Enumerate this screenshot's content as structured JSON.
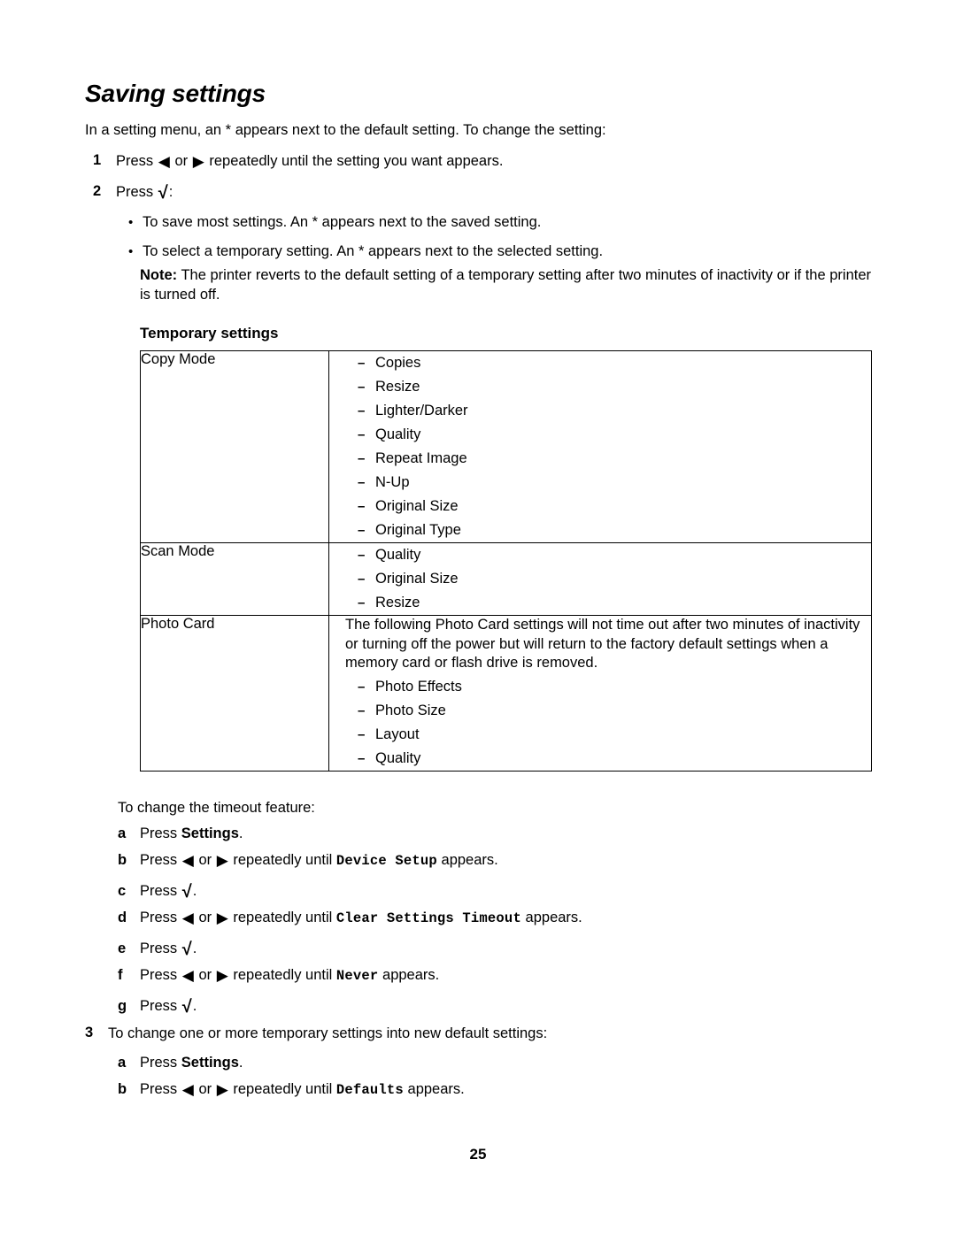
{
  "document": {
    "title": "Saving settings",
    "intro": "In a setting menu, an * appears next to the default setting. To change the setting:",
    "page_number": "25"
  },
  "glyphs": {
    "left_arrow": "◀",
    "right_arrow": "▶",
    "check": "√",
    "bullet": "•",
    "dash": "–"
  },
  "steps": {
    "step1": {
      "marker": "1",
      "text_before": "Press",
      "text_or": "or",
      "text_after": "repeatedly until the setting you want appears."
    },
    "step2": {
      "marker": "2",
      "text_before": "Press",
      "text_after": ":"
    },
    "step3": {
      "marker": "3",
      "text": "To change one or more temporary settings into new default settings:"
    }
  },
  "bullets": [
    {
      "text": "To save most settings. An * appears next to the saved setting."
    },
    {
      "text": "To select a temporary setting. An * appears next to the selected setting."
    }
  ],
  "note": {
    "label": "Note:",
    "text": "The printer reverts to the default setting of a temporary setting after two minutes of inactivity or if the printer is turned off."
  },
  "table": {
    "heading": "Temporary settings",
    "rows": [
      {
        "label": "Copy Mode",
        "paragraph": "",
        "items": [
          "Copies",
          "Resize",
          "Lighter/Darker",
          "Quality",
          "Repeat Image",
          "N-Up",
          "Original Size",
          "Original Type"
        ]
      },
      {
        "label": "Scan Mode",
        "paragraph": "",
        "items": [
          "Quality",
          "Original Size",
          "Resize"
        ]
      },
      {
        "label": "Photo Card",
        "paragraph": "The following Photo Card settings will not time out after two minutes of inactivity or turning off the power but will return to the factory default settings when a memory card or flash drive is removed.",
        "items": [
          "Photo Effects",
          "Photo Size",
          "Layout",
          "Quality"
        ]
      }
    ]
  },
  "timeout_section": {
    "lead": "To change the timeout feature:",
    "steps": [
      {
        "marker": "a",
        "press": "Press",
        "bold_term": "Settings",
        "suffix": "."
      },
      {
        "marker": "b",
        "press": "Press",
        "or": "or",
        "until": "repeatedly until",
        "mono_term": "Device Setup",
        "suffix": "appears."
      },
      {
        "marker": "c",
        "press": "Press",
        "suffix": "."
      },
      {
        "marker": "d",
        "press": "Press",
        "or": "or",
        "until": "repeatedly until",
        "mono_term": "Clear Settings Timeout",
        "suffix": "appears."
      },
      {
        "marker": "e",
        "press": "Press",
        "suffix": "."
      },
      {
        "marker": "f",
        "press": "Press",
        "or": "or",
        "until": "repeatedly until",
        "mono_term": "Never",
        "suffix": "appears."
      },
      {
        "marker": "g",
        "press": "Press",
        "suffix": "."
      }
    ]
  },
  "defaults_section": {
    "steps": [
      {
        "marker": "a",
        "press": "Press",
        "bold_term": "Settings",
        "suffix": "."
      },
      {
        "marker": "b",
        "press": "Press",
        "or": "or",
        "until": "repeatedly until",
        "mono_term": "Defaults",
        "suffix": "appears."
      }
    ]
  }
}
